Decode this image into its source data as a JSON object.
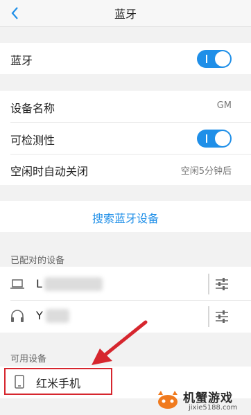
{
  "header": {
    "title": "蓝牙"
  },
  "bluetooth": {
    "label": "蓝牙",
    "enabled": true
  },
  "device_settings": {
    "name_label": "设备名称",
    "name_value": "GM",
    "visibility_label": "可检测性",
    "visibility_enabled": true,
    "auto_off_label": "空闲时自动关闭",
    "auto_off_value": "空闲5分钟后"
  },
  "search": {
    "label": "搜索蓝牙设备"
  },
  "paired": {
    "section_label": "已配对的设备",
    "items": [
      {
        "name": "L",
        "icon": "laptop-icon"
      },
      {
        "name": "Y",
        "icon": "headphones-icon"
      }
    ]
  },
  "available": {
    "section_label": "可用设备",
    "items": [
      {
        "name": "红米手机",
        "icon": "phone-icon"
      }
    ]
  },
  "watermark": {
    "text": "机蟹游戏",
    "url": "jixie5188.com"
  },
  "colors": {
    "accent": "#1f8fe8",
    "highlight": "#d6262e"
  }
}
